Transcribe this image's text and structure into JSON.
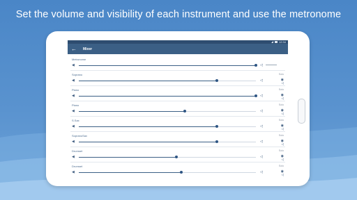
{
  "headline": "Set the volume and visibility of each instrument and use the metronome",
  "status_bar": {
    "time": "12:34"
  },
  "app_bar": {
    "back_icon": "arrow-left-icon",
    "title": "Mixer"
  },
  "colors": {
    "app_bar": "#3b5f85",
    "status_bar": "#2e4d70",
    "accent": "#2e5583"
  },
  "mixer": {
    "solo_label": "Solo",
    "rows": [
      {
        "name": "Metronome",
        "volume": 1.0,
        "show_solo": false
      },
      {
        "name": "Soprano",
        "volume": 0.78,
        "show_solo": true
      },
      {
        "name": "Piano",
        "volume": 1.0,
        "show_solo": true
      },
      {
        "name": "Piano",
        "volume": 0.6,
        "show_solo": true
      },
      {
        "name": "S.Sax",
        "volume": 0.78,
        "show_solo": true
      },
      {
        "name": "SopranoSax",
        "volume": 0.78,
        "show_solo": true
      },
      {
        "name": "Drumset",
        "volume": 0.55,
        "show_solo": true
      },
      {
        "name": "Drumset",
        "volume": 0.58,
        "show_solo": true
      }
    ]
  }
}
